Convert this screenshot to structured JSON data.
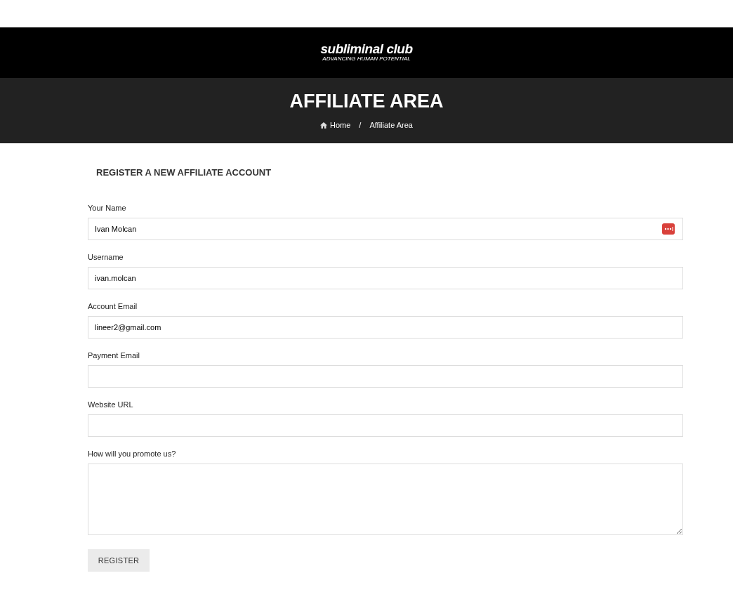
{
  "logo": {
    "name": "subliminal club",
    "tagline": "ADVANCING HUMAN POTENTIAL"
  },
  "page_title": "AFFILIATE AREA",
  "breadcrumb": [
    {
      "label": "Home",
      "kind": "home"
    },
    {
      "label": "/",
      "kind": "separator"
    },
    {
      "label": "Affiliate Area",
      "kind": "current"
    }
  ],
  "form": {
    "heading": "REGISTER A NEW AFFILIATE ACCOUNT",
    "fields": [
      {
        "label": "Your Name",
        "value": "Ivan Molcan",
        "kind": "input",
        "password_manager_icon": true
      },
      {
        "label": "Username",
        "value": "ivan.molcan",
        "kind": "input"
      },
      {
        "label": "Account Email",
        "value": "lineer2@gmail.com",
        "kind": "input"
      },
      {
        "label": "Payment Email",
        "kind": "input"
      },
      {
        "label": "Website URL",
        "kind": "input"
      },
      {
        "label": "How will you promote us?",
        "kind": "textarea"
      }
    ],
    "submit": "REGISTER"
  }
}
